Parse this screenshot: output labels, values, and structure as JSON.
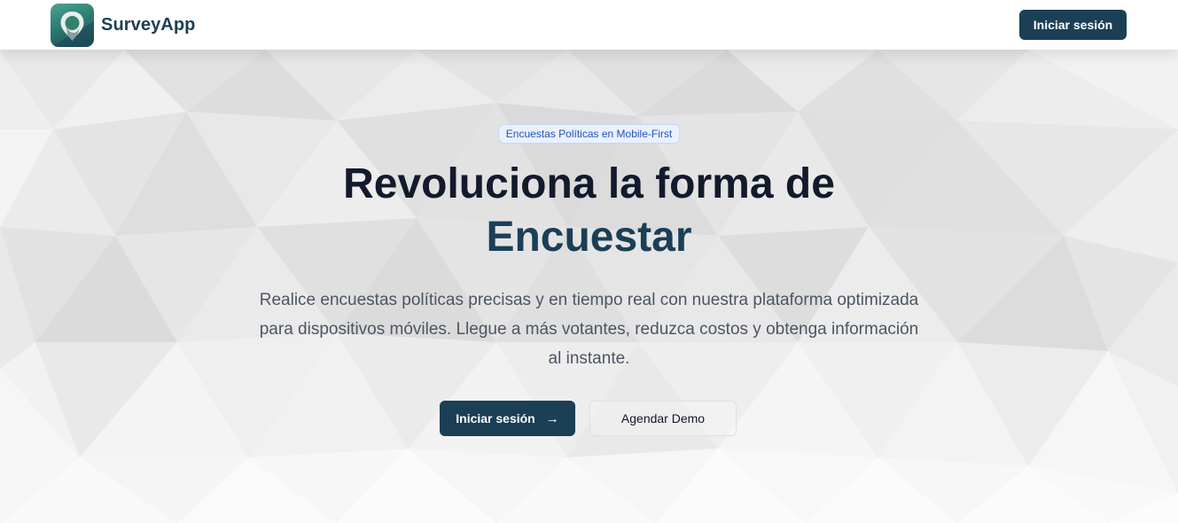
{
  "nav": {
    "brand": "SurveyApp",
    "login_label": "Iniciar sesión"
  },
  "hero": {
    "badge": "Encuestas Políticas en Mobile-First",
    "headline_line1": "Revoluciona la forma de",
    "headline_accent": "Encuestar",
    "description": "Realice encuestas políticas precisas y en tiempo real con nuestra plataforma optimizada para dispositivos móviles. Llegue a más votantes, reduzca costos y obtenga información al instante.",
    "primary_label": "Iniciar sesión",
    "primary_icon": "arrow-right-icon",
    "secondary_label": "Agendar Demo"
  },
  "colors": {
    "brand_dark": "#1b3f55",
    "badge_bg": "#eaf1fd",
    "badge_text": "#2451b8"
  }
}
